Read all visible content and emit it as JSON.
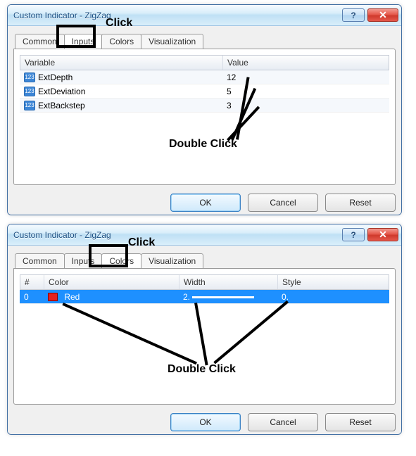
{
  "dialog1": {
    "title": "Custom Indicator - ZigZag",
    "tabs": [
      "Common",
      "Inputs",
      "Colors",
      "Visualization"
    ],
    "active_tab_index": 1,
    "click_label": "Click",
    "double_click_label": "Double Click",
    "inputs": {
      "headers": {
        "variable": "Variable",
        "value": "Value"
      },
      "rows": [
        {
          "icon": "123",
          "name": "ExtDepth",
          "value": "12"
        },
        {
          "icon": "123",
          "name": "ExtDeviation",
          "value": "5"
        },
        {
          "icon": "123",
          "name": "ExtBackstep",
          "value": "3"
        }
      ]
    },
    "buttons": {
      "ok": "OK",
      "cancel": "Cancel",
      "reset": "Reset"
    }
  },
  "dialog2": {
    "title": "Custom Indicator - ZigZag",
    "tabs": [
      "Common",
      "Inputs",
      "Colors",
      "Visualization"
    ],
    "active_tab_index": 2,
    "click_label": "Click",
    "double_click_label": "Double Click",
    "colors": {
      "headers": {
        "index": "#",
        "color": "Color",
        "width": "Width",
        "style": "Style"
      },
      "rows": [
        {
          "index": "0",
          "color_name": "Red",
          "color_hex": "#e52020",
          "width": "2.",
          "style": "0."
        }
      ]
    },
    "buttons": {
      "ok": "OK",
      "cancel": "Cancel",
      "reset": "Reset"
    }
  }
}
